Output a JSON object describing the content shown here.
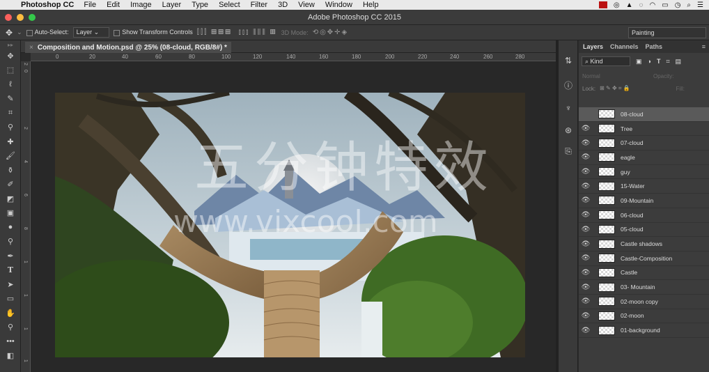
{
  "menubar": {
    "app_name": "Photoshop CC",
    "items": [
      "File",
      "Edit",
      "Image",
      "Layer",
      "Type",
      "Select",
      "Filter",
      "3D",
      "View",
      "Window",
      "Help"
    ]
  },
  "titlebar": {
    "title": "Adobe Photoshop CC 2015"
  },
  "options": {
    "auto_select_label": "Auto-Select:",
    "auto_select_value": "Layer",
    "show_transform_label": "Show Transform Controls",
    "mode_3d_label": "3D Mode:",
    "workspace": "Painting"
  },
  "document": {
    "tab_title": "Composition and Motion.psd @ 25% (08-cloud, RGB/8#) *"
  },
  "rulers": {
    "horizontal": [
      "0",
      "20",
      "40",
      "60",
      "80",
      "100",
      "120",
      "140",
      "160",
      "180",
      "200",
      "220",
      "240",
      "260",
      "280"
    ],
    "vertical": [
      "2",
      "0",
      "2",
      "4",
      "6",
      "8",
      "1",
      "1",
      "1",
      "1",
      "1",
      "1",
      "1",
      "1",
      "1",
      "1",
      "1",
      "1",
      "1"
    ]
  },
  "layers_panel": {
    "tabs": [
      "Layers",
      "Channels",
      "Paths"
    ],
    "filter_kind": "Kind",
    "blend_mode": "Normal",
    "opacity_label": "Opacity:",
    "lock_label": "Lock:",
    "fill_label": "Fill:",
    "layers": [
      {
        "name": "08-cloud",
        "selected": true,
        "visible": false
      },
      {
        "name": "Tree",
        "selected": false,
        "visible": true
      },
      {
        "name": "07-cloud",
        "selected": false,
        "visible": true
      },
      {
        "name": "eagle",
        "selected": false,
        "visible": true
      },
      {
        "name": "guy",
        "selected": false,
        "visible": true
      },
      {
        "name": "15-Water",
        "selected": false,
        "visible": true
      },
      {
        "name": "09-Mountain",
        "selected": false,
        "visible": true
      },
      {
        "name": "06-cloud",
        "selected": false,
        "visible": true
      },
      {
        "name": "05-cloud",
        "selected": false,
        "visible": true
      },
      {
        "name": "Castle shadows",
        "selected": false,
        "visible": true
      },
      {
        "name": "Castle-Composition",
        "selected": false,
        "visible": true
      },
      {
        "name": "Castle",
        "selected": false,
        "visible": true
      },
      {
        "name": "03- Mountain",
        "selected": false,
        "visible": true
      },
      {
        "name": "02-moon copy",
        "selected": false,
        "visible": true
      },
      {
        "name": "02-moon",
        "selected": false,
        "visible": true
      },
      {
        "name": "01-background",
        "selected": false,
        "visible": true
      }
    ]
  },
  "watermark": {
    "cn": "五分钟特效",
    "url": "www.vixcool.com"
  },
  "colors": {
    "accent": "#3b9bd7",
    "selected_layer": "#5a5a5a"
  }
}
